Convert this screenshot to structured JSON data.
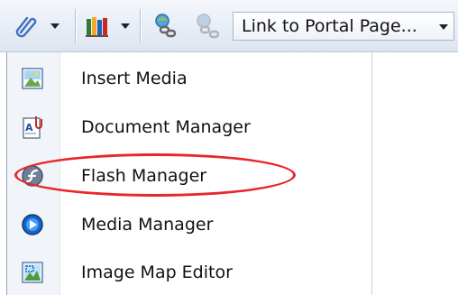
{
  "toolbar": {
    "link_button_icon": "paperclip-link-icon",
    "library_button_icon": "books-library-icon",
    "hyperlink_icon": "chain-link-icon",
    "unlink_icon": "chain-unlink-icon",
    "portal_select": {
      "selected": "Link to Portal Page..."
    }
  },
  "menu": {
    "items": [
      {
        "label": "Insert Media",
        "icon": "insert-media-icon"
      },
      {
        "label": "Document Manager",
        "icon": "document-manager-icon"
      },
      {
        "label": "Flash Manager",
        "icon": "flash-icon"
      },
      {
        "label": "Media Manager",
        "icon": "media-player-icon"
      },
      {
        "label": "Image Map Editor",
        "icon": "image-map-icon"
      }
    ]
  },
  "colors": {
    "highlight": "#e8262b",
    "toolbar_bg": "#e6edf6"
  }
}
